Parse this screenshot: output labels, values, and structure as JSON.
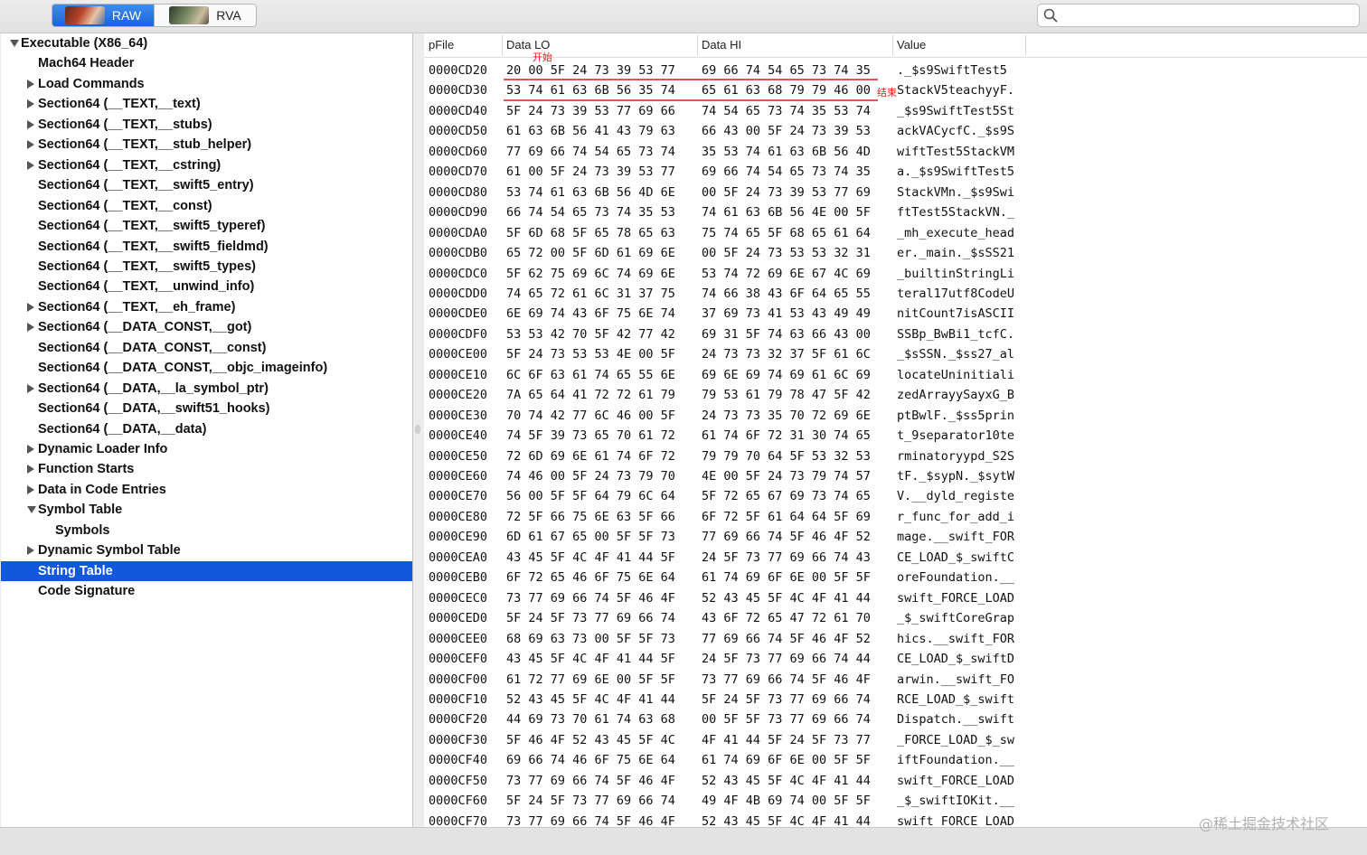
{
  "toolbar": {
    "raw_label": "RAW",
    "rva_label": "RVA",
    "search_placeholder": "",
    "search_value": ""
  },
  "sidebar": {
    "items": [
      {
        "label": "Executable  (X86_64)",
        "level": 0,
        "expander": "expanded"
      },
      {
        "label": "Mach64 Header",
        "level": 1,
        "expander": "none"
      },
      {
        "label": "Load Commands",
        "level": 1,
        "expander": "collapsed"
      },
      {
        "label": "Section64 (__TEXT,__text)",
        "level": 1,
        "expander": "collapsed"
      },
      {
        "label": "Section64 (__TEXT,__stubs)",
        "level": 1,
        "expander": "collapsed"
      },
      {
        "label": "Section64 (__TEXT,__stub_helper)",
        "level": 1,
        "expander": "collapsed"
      },
      {
        "label": "Section64 (__TEXT,__cstring)",
        "level": 1,
        "expander": "collapsed"
      },
      {
        "label": "Section64 (__TEXT,__swift5_entry)",
        "level": 1,
        "expander": "none"
      },
      {
        "label": "Section64 (__TEXT,__const)",
        "level": 1,
        "expander": "none"
      },
      {
        "label": "Section64 (__TEXT,__swift5_typeref)",
        "level": 1,
        "expander": "none"
      },
      {
        "label": "Section64 (__TEXT,__swift5_fieldmd)",
        "level": 1,
        "expander": "none"
      },
      {
        "label": "Section64 (__TEXT,__swift5_types)",
        "level": 1,
        "expander": "none"
      },
      {
        "label": "Section64 (__TEXT,__unwind_info)",
        "level": 1,
        "expander": "none"
      },
      {
        "label": "Section64 (__TEXT,__eh_frame)",
        "level": 1,
        "expander": "collapsed"
      },
      {
        "label": "Section64 (__DATA_CONST,__got)",
        "level": 1,
        "expander": "collapsed"
      },
      {
        "label": "Section64 (__DATA_CONST,__const)",
        "level": 1,
        "expander": "none"
      },
      {
        "label": "Section64 (__DATA_CONST,__objc_imageinfo)",
        "level": 1,
        "expander": "none"
      },
      {
        "label": "Section64 (__DATA,__la_symbol_ptr)",
        "level": 1,
        "expander": "collapsed"
      },
      {
        "label": "Section64 (__DATA,__swift51_hooks)",
        "level": 1,
        "expander": "none"
      },
      {
        "label": "Section64 (__DATA,__data)",
        "level": 1,
        "expander": "none"
      },
      {
        "label": "Dynamic Loader Info",
        "level": 1,
        "expander": "collapsed"
      },
      {
        "label": "Function Starts",
        "level": 1,
        "expander": "collapsed"
      },
      {
        "label": "Data in Code Entries",
        "level": 1,
        "expander": "collapsed"
      },
      {
        "label": "Symbol Table",
        "level": 1,
        "expander": "expanded"
      },
      {
        "label": "Symbols",
        "level": 2,
        "expander": "none"
      },
      {
        "label": "Dynamic Symbol Table",
        "level": 1,
        "expander": "collapsed"
      },
      {
        "label": "String Table",
        "level": 1,
        "expander": "none",
        "selected": true
      },
      {
        "label": "Code Signature",
        "level": 1,
        "expander": "none"
      }
    ]
  },
  "table": {
    "headers": [
      "pFile",
      "Data LO",
      "Data HI",
      "Value"
    ],
    "rows": [
      [
        "0000CD20",
        "20 00 5F 24 73 39 53 77",
        "69 66 74 54 65 73 74 35",
        "._$s9SwiftTest5"
      ],
      [
        "0000CD30",
        "53 74 61 63 6B 56 35 74",
        "65 61 63 68 79 79 46 00",
        "StackV5teachyyF."
      ],
      [
        "0000CD40",
        "5F 24 73 39 53 77 69 66",
        "74 54 65 73 74 35 53 74",
        "_$s9SwiftTest5St"
      ],
      [
        "0000CD50",
        "61 63 6B 56 41 43 79 63",
        "66 43 00 5F 24 73 39 53",
        "ackVACycfC._$s9S"
      ],
      [
        "0000CD60",
        "77 69 66 74 54 65 73 74",
        "35 53 74 61 63 6B 56 4D",
        "wiftTest5StackVM"
      ],
      [
        "0000CD70",
        "61 00 5F 24 73 39 53 77",
        "69 66 74 54 65 73 74 35",
        "a._$s9SwiftTest5"
      ],
      [
        "0000CD80",
        "53 74 61 63 6B 56 4D 6E",
        "00 5F 24 73 39 53 77 69",
        "StackVMn._$s9Swi"
      ],
      [
        "0000CD90",
        "66 74 54 65 73 74 35 53",
        "74 61 63 6B 56 4E 00 5F",
        "ftTest5StackVN._"
      ],
      [
        "0000CDA0",
        "5F 6D 68 5F 65 78 65 63",
        "75 74 65 5F 68 65 61 64",
        "_mh_execute_head"
      ],
      [
        "0000CDB0",
        "65 72 00 5F 6D 61 69 6E",
        "00 5F 24 73 53 53 32 31",
        "er._main._$sSS21"
      ],
      [
        "0000CDC0",
        "5F 62 75 69 6C 74 69 6E",
        "53 74 72 69 6E 67 4C 69",
        "_builtinStringLi"
      ],
      [
        "0000CDD0",
        "74 65 72 61 6C 31 37 75",
        "74 66 38 43 6F 64 65 55",
        "teral17utf8CodeU"
      ],
      [
        "0000CDE0",
        "6E 69 74 43 6F 75 6E 74",
        "37 69 73 41 53 43 49 49",
        "nitCount7isASCII"
      ],
      [
        "0000CDF0",
        "53 53 42 70 5F 42 77 42",
        "69 31 5F 74 63 66 43 00",
        "SSBp_BwBi1_tcfC."
      ],
      [
        "0000CE00",
        "5F 24 73 53 53 4E 00 5F",
        "24 73 73 32 37 5F 61 6C",
        "_$sSSN._$ss27_al"
      ],
      [
        "0000CE10",
        "6C 6F 63 61 74 65 55 6E",
        "69 6E 69 74 69 61 6C 69",
        "locateUninitiali"
      ],
      [
        "0000CE20",
        "7A 65 64 41 72 72 61 79",
        "79 53 61 79 78 47 5F 42",
        "zedArrayySayxG_B"
      ],
      [
        "0000CE30",
        "70 74 42 77 6C 46 00 5F",
        "24 73 73 35 70 72 69 6E",
        "ptBwlF._$ss5prin"
      ],
      [
        "0000CE40",
        "74 5F 39 73 65 70 61 72",
        "61 74 6F 72 31 30 74 65",
        "t_9separator10te"
      ],
      [
        "0000CE50",
        "72 6D 69 6E 61 74 6F 72",
        "79 79 70 64 5F 53 32 53",
        "rminatoryypd_S2S"
      ],
      [
        "0000CE60",
        "74 46 00 5F 24 73 79 70",
        "4E 00 5F 24 73 79 74 57",
        "tF._$sypN._$sytW"
      ],
      [
        "0000CE70",
        "56 00 5F 5F 64 79 6C 64",
        "5F 72 65 67 69 73 74 65",
        "V.__dyld_registe"
      ],
      [
        "0000CE80",
        "72 5F 66 75 6E 63 5F 66",
        "6F 72 5F 61 64 64 5F 69",
        "r_func_for_add_i"
      ],
      [
        "0000CE90",
        "6D 61 67 65 00 5F 5F 73",
        "77 69 66 74 5F 46 4F 52",
        "mage.__swift_FOR"
      ],
      [
        "0000CEA0",
        "43 45 5F 4C 4F 41 44 5F",
        "24 5F 73 77 69 66 74 43",
        "CE_LOAD_$_swiftC"
      ],
      [
        "0000CEB0",
        "6F 72 65 46 6F 75 6E 64",
        "61 74 69 6F 6E 00 5F 5F",
        "oreFoundation.__"
      ],
      [
        "0000CEC0",
        "73 77 69 66 74 5F 46 4F",
        "52 43 45 5F 4C 4F 41 44",
        "swift_FORCE_LOAD"
      ],
      [
        "0000CED0",
        "5F 24 5F 73 77 69 66 74",
        "43 6F 72 65 47 72 61 70",
        "_$_swiftCoreGrap"
      ],
      [
        "0000CEE0",
        "68 69 63 73 00 5F 5F 73",
        "77 69 66 74 5F 46 4F 52",
        "hics.__swift_FOR"
      ],
      [
        "0000CEF0",
        "43 45 5F 4C 4F 41 44 5F",
        "24 5F 73 77 69 66 74 44",
        "CE_LOAD_$_swiftD"
      ],
      [
        "0000CF00",
        "61 72 77 69 6E 00 5F 5F",
        "73 77 69 66 74 5F 46 4F",
        "arwin.__swift_FO"
      ],
      [
        "0000CF10",
        "52 43 45 5F 4C 4F 41 44",
        "5F 24 5F 73 77 69 66 74",
        "RCE_LOAD_$_swift"
      ],
      [
        "0000CF20",
        "44 69 73 70 61 74 63 68",
        "00 5F 5F 73 77 69 66 74",
        "Dispatch.__swift"
      ],
      [
        "0000CF30",
        "5F 46 4F 52 43 45 5F 4C",
        "4F 41 44 5F 24 5F 73 77",
        "_FORCE_LOAD_$_sw"
      ],
      [
        "0000CF40",
        "69 66 74 46 6F 75 6E 64",
        "61 74 69 6F 6E 00 5F 5F",
        "iftFoundation.__"
      ],
      [
        "0000CF50",
        "73 77 69 66 74 5F 46 4F",
        "52 43 45 5F 4C 4F 41 44",
        "swift_FORCE_LOAD"
      ],
      [
        "0000CF60",
        "5F 24 5F 73 77 69 66 74",
        "49 4F 4B 69 74 00 5F 5F",
        "_$_swiftIOKit.__"
      ],
      [
        "0000CF70",
        "73 77 69 66 74 5F 46 4F",
        "52 43 45 5F 4C 4F 41 44",
        "swift_FORCE_LOAD"
      ]
    ]
  },
  "annotations": {
    "start_label": "开始",
    "end_label": "结束",
    "color": "#e31d1d"
  },
  "watermark": "@稀土掘金技术社区",
  "colors": {
    "selection": "#1258dc",
    "raw_active": "#2b78e8"
  }
}
